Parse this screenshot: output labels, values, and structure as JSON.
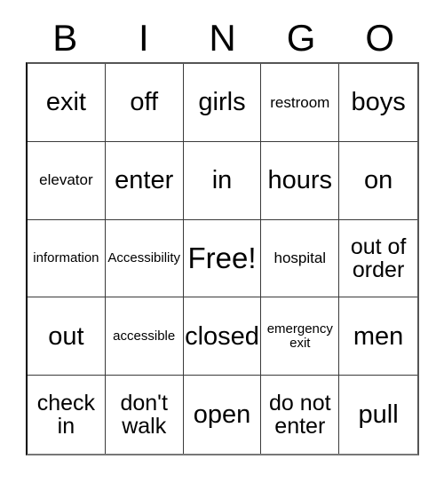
{
  "card": {
    "title_letters": [
      "B",
      "I",
      "N",
      "G",
      "O"
    ],
    "grid_size": "5x5",
    "free_space_label": "Free!",
    "colors": {
      "background": "#ffffff",
      "text": "#000000",
      "grid_line": "#3a3a3a",
      "grid_outer": "#555555"
    },
    "rows": [
      [
        {
          "text": "exit",
          "size": "lg"
        },
        {
          "text": "off",
          "size": "lg"
        },
        {
          "text": "girls",
          "size": "lg"
        },
        {
          "text": "restroom",
          "size": "sm"
        },
        {
          "text": "boys",
          "size": "lg"
        }
      ],
      [
        {
          "text": "elevator",
          "size": "sm"
        },
        {
          "text": "enter",
          "size": "lg"
        },
        {
          "text": "in",
          "size": "lg"
        },
        {
          "text": "hours",
          "size": "lg"
        },
        {
          "text": "on",
          "size": "lg"
        }
      ],
      [
        {
          "text": "information",
          "size": "xs"
        },
        {
          "text": "Accessibility",
          "size": "xs"
        },
        {
          "text": "Free!",
          "size": "xl"
        },
        {
          "text": "hospital",
          "size": "sm"
        },
        {
          "text": "out of order",
          "size": "md"
        }
      ],
      [
        {
          "text": "out",
          "size": "lg"
        },
        {
          "text": "accessible",
          "size": "xs"
        },
        {
          "text": "closed",
          "size": "lg"
        },
        {
          "text": "emergency exit",
          "size": "xs"
        },
        {
          "text": "men",
          "size": "lg"
        }
      ],
      [
        {
          "text": "check in",
          "size": "md"
        },
        {
          "text": "don't walk",
          "size": "md"
        },
        {
          "text": "open",
          "size": "lg"
        },
        {
          "text": "do not enter",
          "size": "md"
        },
        {
          "text": "pull",
          "size": "lg"
        }
      ]
    ]
  }
}
